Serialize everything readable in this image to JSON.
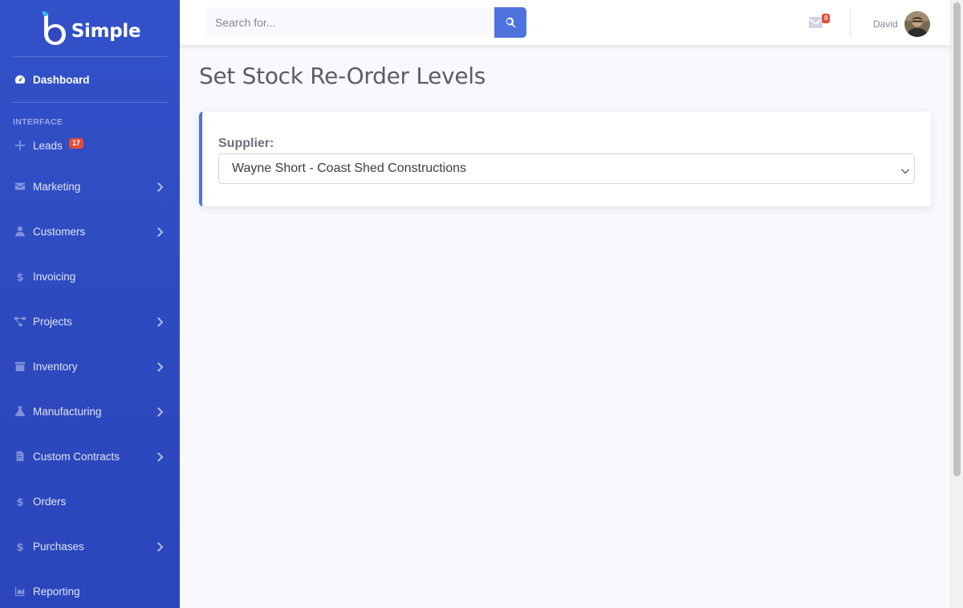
{
  "brand": {
    "name": "Simple"
  },
  "sidebar": {
    "dashboard": {
      "label": "Dashboard"
    },
    "heading": "INTERFACE",
    "items": [
      {
        "label": "Leads",
        "icon": "plus-icon",
        "badge": "17",
        "has_submenu": false
      },
      {
        "label": "Marketing",
        "icon": "envelope-icon",
        "has_submenu": true
      },
      {
        "label": "Customers",
        "icon": "user-icon",
        "has_submenu": true
      },
      {
        "label": "Invoicing",
        "icon": "dollar-icon",
        "has_submenu": false
      },
      {
        "label": "Projects",
        "icon": "project-diagram-icon",
        "has_submenu": true
      },
      {
        "label": "Inventory",
        "icon": "box-icon",
        "has_submenu": true
      },
      {
        "label": "Manufacturing",
        "icon": "flask-icon",
        "has_submenu": true
      },
      {
        "label": "Custom Contracts",
        "icon": "file-contract-icon",
        "has_submenu": true
      },
      {
        "label": "Orders",
        "icon": "dollar-icon",
        "has_submenu": false
      },
      {
        "label": "Purchases",
        "icon": "dollar-icon",
        "has_submenu": true
      },
      {
        "label": "Reporting",
        "icon": "chart-area-icon",
        "has_submenu": false
      }
    ]
  },
  "topbar": {
    "search": {
      "placeholder": "Search for..."
    },
    "messages": {
      "count": "0"
    },
    "user": {
      "name": "David"
    }
  },
  "page": {
    "title": "Set Stock Re-Order Levels",
    "supplier": {
      "label": "Supplier:",
      "selected": "Wayne Short - Coast Shed Constructions"
    }
  },
  "colors": {
    "sidebar": "#2e49be",
    "primary": "#4e73df",
    "danger": "#e74a3b",
    "background": "#f8f9fc"
  }
}
